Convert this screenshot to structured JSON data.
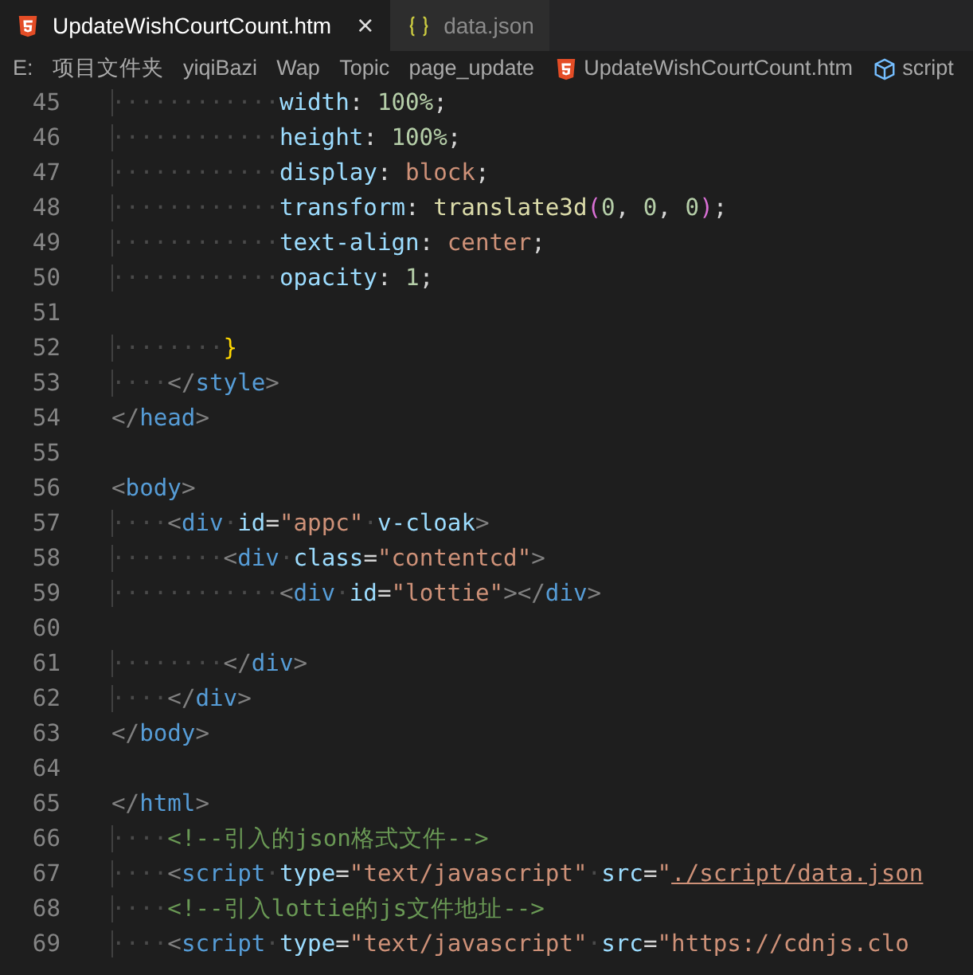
{
  "tabs": [
    {
      "label": "UpdateWishCourtCount.htm",
      "kind": "html",
      "selected": true,
      "close": "×"
    },
    {
      "label": "data.json",
      "kind": "json",
      "selected": false
    }
  ],
  "breadcrumbs": [
    {
      "label": "E:",
      "kind": "plain"
    },
    {
      "label": "项目文件夹",
      "kind": "plain"
    },
    {
      "label": "yiqiBazi",
      "kind": "plain"
    },
    {
      "label": "Wap",
      "kind": "plain"
    },
    {
      "label": "Topic",
      "kind": "plain"
    },
    {
      "label": "page_update",
      "kind": "plain"
    },
    {
      "label": "UpdateWishCourtCount.htm",
      "kind": "html"
    },
    {
      "label": "script",
      "kind": "symbol"
    }
  ],
  "lines": [
    {
      "number": "45",
      "tokens": [
        {
          "kind": "ws",
          "t": "············"
        },
        {
          "kind": "prop",
          "t": "width"
        },
        {
          "kind": "p",
          "t": ": "
        },
        {
          "kind": "num",
          "t": "100%"
        },
        {
          "kind": "p",
          "t": ";"
        }
      ]
    },
    {
      "number": "46",
      "tokens": [
        {
          "kind": "ws",
          "t": "············"
        },
        {
          "kind": "prop",
          "t": "height"
        },
        {
          "kind": "p",
          "t": ": "
        },
        {
          "kind": "num",
          "t": "100%"
        },
        {
          "kind": "p",
          "t": ";"
        }
      ]
    },
    {
      "number": "47",
      "tokens": [
        {
          "kind": "ws",
          "t": "············"
        },
        {
          "kind": "prop",
          "t": "display"
        },
        {
          "kind": "p",
          "t": ": "
        },
        {
          "kind": "str",
          "t": "block"
        },
        {
          "kind": "p",
          "t": ";"
        }
      ]
    },
    {
      "number": "48",
      "tokens": [
        {
          "kind": "ws",
          "t": "············"
        },
        {
          "kind": "prop",
          "t": "transform"
        },
        {
          "kind": "p",
          "t": ": "
        },
        {
          "kind": "fn",
          "t": "translate3d"
        },
        {
          "kind": "paren",
          "t": "("
        },
        {
          "kind": "num",
          "t": "0"
        },
        {
          "kind": "p",
          "t": ", "
        },
        {
          "kind": "num",
          "t": "0"
        },
        {
          "kind": "p",
          "t": ", "
        },
        {
          "kind": "num",
          "t": "0"
        },
        {
          "kind": "paren",
          "t": ")"
        },
        {
          "kind": "p",
          "t": ";"
        }
      ]
    },
    {
      "number": "49",
      "tokens": [
        {
          "kind": "ws",
          "t": "············"
        },
        {
          "kind": "prop",
          "t": "text-align"
        },
        {
          "kind": "p",
          "t": ": "
        },
        {
          "kind": "str",
          "t": "center"
        },
        {
          "kind": "p",
          "t": ";"
        }
      ]
    },
    {
      "number": "50",
      "tokens": [
        {
          "kind": "ws",
          "t": "············"
        },
        {
          "kind": "prop",
          "t": "opacity"
        },
        {
          "kind": "p",
          "t": ": "
        },
        {
          "kind": "num",
          "t": "1"
        },
        {
          "kind": "p",
          "t": ";"
        }
      ]
    },
    {
      "number": "51"
    },
    {
      "number": "52",
      "tokens": [
        {
          "kind": "ws",
          "t": "········"
        },
        {
          "kind": "brace",
          "t": "}"
        }
      ]
    },
    {
      "number": "53",
      "tokens": [
        {
          "kind": "ws",
          "t": "····"
        },
        {
          "kind": "br",
          "t": "</"
        },
        {
          "kind": "tag",
          "t": "style"
        },
        {
          "kind": "br",
          "t": ">"
        }
      ]
    },
    {
      "number": "54",
      "tokens": [
        {
          "kind": "br",
          "t": "</"
        },
        {
          "kind": "tag",
          "t": "head"
        },
        {
          "kind": "br",
          "t": ">"
        }
      ]
    },
    {
      "number": "55"
    },
    {
      "number": "56",
      "tokens": [
        {
          "kind": "br",
          "t": "<"
        },
        {
          "kind": "tag",
          "t": "body"
        },
        {
          "kind": "br",
          "t": ">"
        }
      ]
    },
    {
      "number": "57",
      "tokens": [
        {
          "kind": "ws",
          "t": "····"
        },
        {
          "kind": "br",
          "t": "<"
        },
        {
          "kind": "tag",
          "t": "div"
        },
        {
          "kind": "sp",
          "t": "·"
        },
        {
          "kind": "attr",
          "t": "id"
        },
        {
          "kind": "p",
          "t": "="
        },
        {
          "kind": "str",
          "t": "\"appc\""
        },
        {
          "kind": "sp",
          "t": "·"
        },
        {
          "kind": "attr",
          "t": "v-cloak"
        },
        {
          "kind": "br",
          "t": ">"
        }
      ]
    },
    {
      "number": "58",
      "tokens": [
        {
          "kind": "ws",
          "t": "········"
        },
        {
          "kind": "br",
          "t": "<"
        },
        {
          "kind": "tag",
          "t": "div"
        },
        {
          "kind": "sp",
          "t": "·"
        },
        {
          "kind": "attr",
          "t": "class"
        },
        {
          "kind": "p",
          "t": "="
        },
        {
          "kind": "str",
          "t": "\"contentcd\""
        },
        {
          "kind": "br",
          "t": ">"
        }
      ]
    },
    {
      "number": "59",
      "tokens": [
        {
          "kind": "ws",
          "t": "············"
        },
        {
          "kind": "br",
          "t": "<"
        },
        {
          "kind": "tag",
          "t": "div"
        },
        {
          "kind": "sp",
          "t": "·"
        },
        {
          "kind": "attr",
          "t": "id"
        },
        {
          "kind": "p",
          "t": "="
        },
        {
          "kind": "str",
          "t": "\"lottie\""
        },
        {
          "kind": "br",
          "t": "></"
        },
        {
          "kind": "tag",
          "t": "div"
        },
        {
          "kind": "br",
          "t": ">"
        }
      ]
    },
    {
      "number": "60"
    },
    {
      "number": "61",
      "tokens": [
        {
          "kind": "ws",
          "t": "········"
        },
        {
          "kind": "br",
          "t": "</"
        },
        {
          "kind": "tag",
          "t": "div"
        },
        {
          "kind": "br",
          "t": ">"
        }
      ]
    },
    {
      "number": "62",
      "tokens": [
        {
          "kind": "ws",
          "t": "····"
        },
        {
          "kind": "br",
          "t": "</"
        },
        {
          "kind": "tag",
          "t": "div"
        },
        {
          "kind": "br",
          "t": ">"
        }
      ]
    },
    {
      "number": "63",
      "tokens": [
        {
          "kind": "br",
          "t": "</"
        },
        {
          "kind": "tag",
          "t": "body"
        },
        {
          "kind": "br",
          "t": ">"
        }
      ]
    },
    {
      "number": "64"
    },
    {
      "number": "65",
      "tokens": [
        {
          "kind": "br",
          "t": "</"
        },
        {
          "kind": "tag",
          "t": "html"
        },
        {
          "kind": "br",
          "t": ">"
        }
      ]
    },
    {
      "number": "66",
      "tokens": [
        {
          "kind": "ws",
          "t": "····"
        },
        {
          "kind": "com",
          "t": "<!--引入的json格式文件-->"
        }
      ]
    },
    {
      "number": "67",
      "tokens": [
        {
          "kind": "ws",
          "t": "····"
        },
        {
          "kind": "br",
          "t": "<"
        },
        {
          "kind": "tag",
          "t": "script"
        },
        {
          "kind": "sp",
          "t": "·"
        },
        {
          "kind": "attr",
          "t": "type"
        },
        {
          "kind": "p",
          "t": "="
        },
        {
          "kind": "str",
          "t": "\"text/javascript\""
        },
        {
          "kind": "sp",
          "t": "·"
        },
        {
          "kind": "attr",
          "t": "src"
        },
        {
          "kind": "p",
          "t": "="
        },
        {
          "kind": "str",
          "t": "\""
        },
        {
          "kind": "link",
          "t": "./script/data.json"
        }
      ]
    },
    {
      "number": "68",
      "tokens": [
        {
          "kind": "ws",
          "t": "····"
        },
        {
          "kind": "com",
          "t": "<!--引入lottie的js文件地址-->"
        }
      ]
    },
    {
      "number": "69",
      "tokens": [
        {
          "kind": "ws",
          "t": "····"
        },
        {
          "kind": "br",
          "t": "<"
        },
        {
          "kind": "tag",
          "t": "script"
        },
        {
          "kind": "sp",
          "t": "·"
        },
        {
          "kind": "attr",
          "t": "type"
        },
        {
          "kind": "p",
          "t": "="
        },
        {
          "kind": "str",
          "t": "\"text/javascript\""
        },
        {
          "kind": "sp",
          "t": "·"
        },
        {
          "kind": "attr",
          "t": "src"
        },
        {
          "kind": "p",
          "t": "="
        },
        {
          "kind": "str",
          "t": "\"https://cdnjs.clo"
        }
      ]
    }
  ]
}
